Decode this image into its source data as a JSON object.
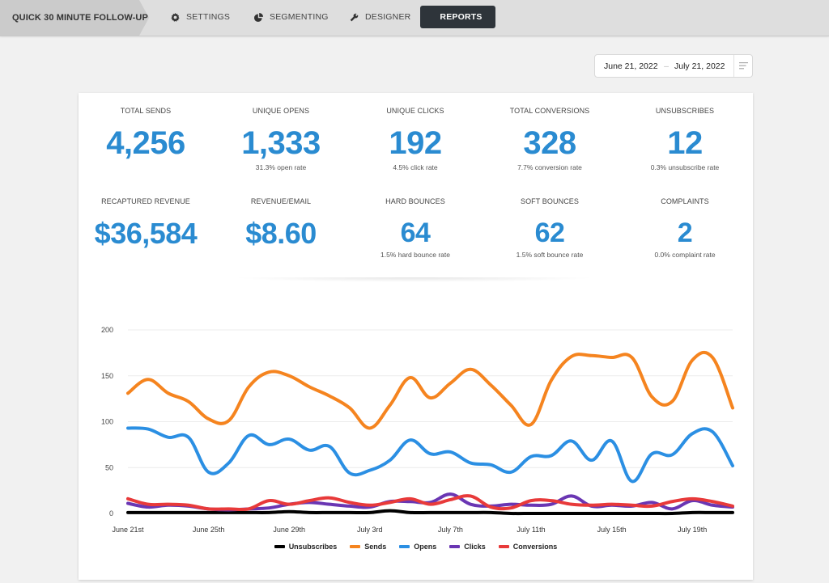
{
  "nav": {
    "campaign_title": "QUICK 30 MINUTE FOLLOW-UP",
    "items": [
      {
        "label": "SETTINGS",
        "icon": "gear-icon",
        "active": false
      },
      {
        "label": "SEGMENTING",
        "icon": "pie-chart-icon",
        "active": false
      },
      {
        "label": "DESIGNER",
        "icon": "wrench-icon",
        "active": false
      },
      {
        "label": "REPORTS",
        "icon": "line-chart-icon",
        "active": true
      }
    ]
  },
  "date_range": {
    "start": "June 21, 2022",
    "separator": "–",
    "end": "July 21, 2022",
    "menu_icon": "filter-lines-icon"
  },
  "stats_row1": [
    {
      "label": "TOTAL SENDS",
      "value": "4,256",
      "sub": ""
    },
    {
      "label": "UNIQUE OPENS",
      "value": "1,333",
      "sub": "31.3% open rate"
    },
    {
      "label": "UNIQUE CLICKS",
      "value": "192",
      "sub": "4.5% click rate"
    },
    {
      "label": "TOTAL CONVERSIONS",
      "value": "328",
      "sub": "7.7% conversion rate"
    },
    {
      "label": "UNSUBSCRIBES",
      "value": "12",
      "sub": "0.3% unsubscribe rate"
    }
  ],
  "stats_row2": [
    {
      "label": "RECAPTURED REVENUE",
      "value": "$36,584",
      "sub": ""
    },
    {
      "label": "REVENUE/EMAIL",
      "value": "$8.60",
      "sub": ""
    },
    {
      "label": "HARD BOUNCES",
      "value": "64",
      "sub": "1.5% hard bounce rate"
    },
    {
      "label": "SOFT BOUNCES",
      "value": "62",
      "sub": "1.5% soft bounce rate"
    },
    {
      "label": "COMPLAINTS",
      "value": "2",
      "sub": "0.0% complaint rate"
    }
  ],
  "chart_data": {
    "type": "line",
    "title": "",
    "xlabel": "",
    "ylabel": "",
    "ylim": [
      0,
      200
    ],
    "yticks": [
      0,
      50,
      100,
      150,
      200
    ],
    "grid": true,
    "legend_position": "bottom-center",
    "x": [
      "June 21",
      "June 22",
      "June 23",
      "June 24",
      "June 25",
      "June 26",
      "June 27",
      "June 28",
      "June 29",
      "June 30",
      "July 1",
      "July 2",
      "July 3",
      "July 4",
      "July 5",
      "July 6",
      "July 7",
      "July 8",
      "July 9",
      "July 10",
      "July 11",
      "July 12",
      "July 13",
      "July 14",
      "July 15",
      "July 16",
      "July 17",
      "July 18",
      "July 19",
      "July 20",
      "July 21"
    ],
    "xtick_labels": [
      {
        "index": 0,
        "label": "June 21st"
      },
      {
        "index": 4,
        "label": "June 25th"
      },
      {
        "index": 8,
        "label": "June 29th"
      },
      {
        "index": 12,
        "label": "July 3rd"
      },
      {
        "index": 16,
        "label": "July 7th"
      },
      {
        "index": 20,
        "label": "July 11th"
      },
      {
        "index": 24,
        "label": "July 15th"
      },
      {
        "index": 28,
        "label": "July 19th"
      }
    ],
    "series": [
      {
        "name": "Unsubscribes",
        "color": "#000000",
        "values": [
          1,
          1,
          1,
          1,
          1,
          1,
          1,
          1,
          2,
          1,
          1,
          1,
          1,
          3,
          1,
          1,
          1,
          1,
          1,
          0,
          0,
          0,
          0,
          0,
          0,
          0,
          0,
          0,
          1,
          1,
          1
        ]
      },
      {
        "name": "Sends",
        "color": "#f5841f",
        "values": [
          131,
          146,
          131,
          122,
          103,
          101,
          138,
          154,
          150,
          138,
          128,
          115,
          93,
          118,
          148,
          126,
          142,
          157,
          140,
          118,
          97,
          145,
          171,
          172,
          170,
          170,
          127,
          122,
          167,
          170,
          115
        ]
      },
      {
        "name": "Opens",
        "color": "#2b8fe3",
        "values": [
          93,
          92,
          83,
          83,
          45,
          55,
          85,
          75,
          81,
          69,
          73,
          44,
          47,
          58,
          80,
          65,
          67,
          55,
          53,
          45,
          62,
          63,
          79,
          58,
          79,
          35,
          65,
          64,
          87,
          89,
          52
        ]
      },
      {
        "name": "Clicks",
        "color": "#6a36b3",
        "values": [
          11,
          7,
          9,
          8,
          5,
          4,
          5,
          6,
          10,
          12,
          10,
          8,
          7,
          13,
          13,
          12,
          21,
          10,
          8,
          10,
          9,
          10,
          19,
          8,
          9,
          8,
          12,
          5,
          14,
          9,
          7
        ]
      },
      {
        "name": "Conversions",
        "color": "#e83a3a",
        "values": [
          16,
          10,
          10,
          9,
          5,
          5,
          5,
          14,
          10,
          14,
          17,
          12,
          9,
          12,
          16,
          10,
          15,
          19,
          7,
          6,
          14,
          14,
          10,
          9,
          10,
          9,
          8,
          13,
          16,
          13,
          8
        ]
      }
    ]
  }
}
